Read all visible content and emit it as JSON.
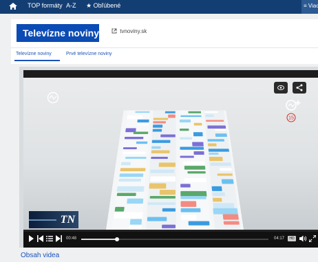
{
  "topnav": {
    "home_icon": "home-icon",
    "items": [
      {
        "label": "TOP formáty"
      },
      {
        "label": "A-Z"
      },
      {
        "label": "Obľúbené",
        "icon": "star-icon"
      }
    ],
    "more_label": "Viac"
  },
  "header": {
    "title": "Televízne noviny",
    "external_link": {
      "label": "tvnoviny.sk",
      "icon": "external-link-icon"
    }
  },
  "tabs": [
    {
      "label": "Televízne noviny",
      "active": true
    },
    {
      "label": "Prvé televízne noviny",
      "active": false
    }
  ],
  "player": {
    "logo_text": "TN",
    "badge_number": "15",
    "time_current": "00:48",
    "time_total": "04:17",
    "quality_label": "HD",
    "progress": 0.19,
    "icons": [
      "play-icon",
      "previous-icon",
      "playlist-icon",
      "next-icon",
      "volume-icon",
      "fullscreen-icon",
      "eye-icon",
      "share-icon",
      "replay-icon",
      "add-icon"
    ]
  },
  "section": {
    "title": "Obsah videa"
  },
  "colors": {
    "nav_bg": "#133e74",
    "accent": "#0b4bb4",
    "badge_red": "#d8342c"
  }
}
